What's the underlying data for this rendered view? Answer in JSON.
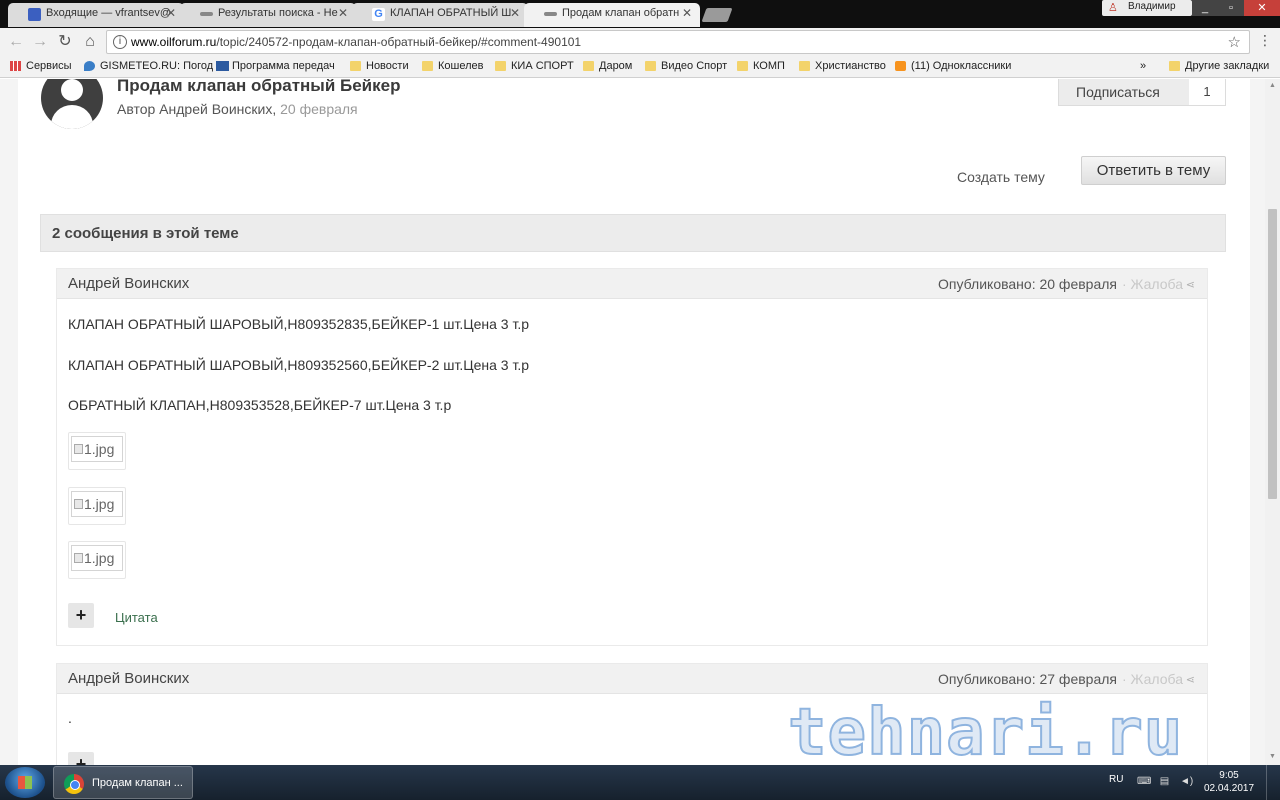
{
  "browser": {
    "tabs": [
      {
        "label": "Входящие — vfrantsev@",
        "icon": "mail-icon",
        "color": "#3b5fc0"
      },
      {
        "label": "Результаты поиска - Не",
        "icon": "forum-icon",
        "color": "#888888"
      },
      {
        "label": "КЛАПАН ОБРАТНЫЙ Ш",
        "icon": "google-icon",
        "color": "#4285f4"
      },
      {
        "label": "Продам клапан обратн",
        "icon": "forum-icon",
        "color": "#888888"
      }
    ],
    "user_name": "Владимир",
    "url_host": "www.oilforum.ru",
    "url_path": "/topic/240572-продам-клапан-обратный-бейкер/#comment-490101",
    "bookmarks": [
      {
        "label": "Сервисы",
        "icon": "apps-icon"
      },
      {
        "label": "GISMETEO.RU: Погод",
        "icon": "weather-icon"
      },
      {
        "label": "Программа передач",
        "icon": "tv-icon"
      },
      {
        "label": "Новости",
        "icon": "folder-icon"
      },
      {
        "label": "Кошелев",
        "icon": "folder-icon"
      },
      {
        "label": "КИА СПОРТ",
        "icon": "folder-icon"
      },
      {
        "label": "Даром",
        "icon": "folder-icon"
      },
      {
        "label": "Видео Спорт",
        "icon": "folder-icon"
      },
      {
        "label": "КОМП",
        "icon": "folder-icon"
      },
      {
        "label": "Христианство",
        "icon": "folder-icon"
      },
      {
        "label": "(11) Одноклассники",
        "icon": "ok-icon"
      }
    ],
    "bookmarks_overflow": "»",
    "other_bookmarks": "Другие закладки"
  },
  "topic": {
    "title": "Продам клапан обратный Бейкер",
    "author_prefix": "Автор Андрей Воинских,",
    "date": "20 февраля",
    "follow_label": "Подписаться",
    "follow_count": "1",
    "create_topic": "Создать тему",
    "reply_label": "Ответить в тему",
    "posts_count_label": "2 сообщения в этой теме"
  },
  "posts": [
    {
      "author": "Андрей Воинских",
      "published": "Опубликовано: 20 февраля",
      "report": "· Жалоба",
      "lines": [
        "КЛАПАН ОБРАТНЫЙ ШАРОВЫЙ,Н809352835,БЕЙКЕР-1 шт.Цена 3 т.р",
        "КЛАПАН ОБРАТНЫЙ ШАРОВЫЙ,Н809352560,БЕЙКЕР-2 шт.Цена 3 т.р",
        "ОБРАТНЫЙ КЛАПАН,Н809353528,БЕЙКЕР-7 шт.Цена 3 т.р"
      ],
      "attachments": [
        "1.jpg",
        "1.jpg",
        "1.jpg"
      ],
      "quote_label": "Цитата"
    },
    {
      "author": "Андрей Воинских",
      "published": "Опубликовано: 27 февраля",
      "report": "· Жалоба",
      "body": "."
    }
  ],
  "watermark": "tehnari.ru",
  "taskbar": {
    "task_label": "Продам клапан ...",
    "lang": "RU",
    "time": "9:05",
    "date": "02.04.2017"
  }
}
